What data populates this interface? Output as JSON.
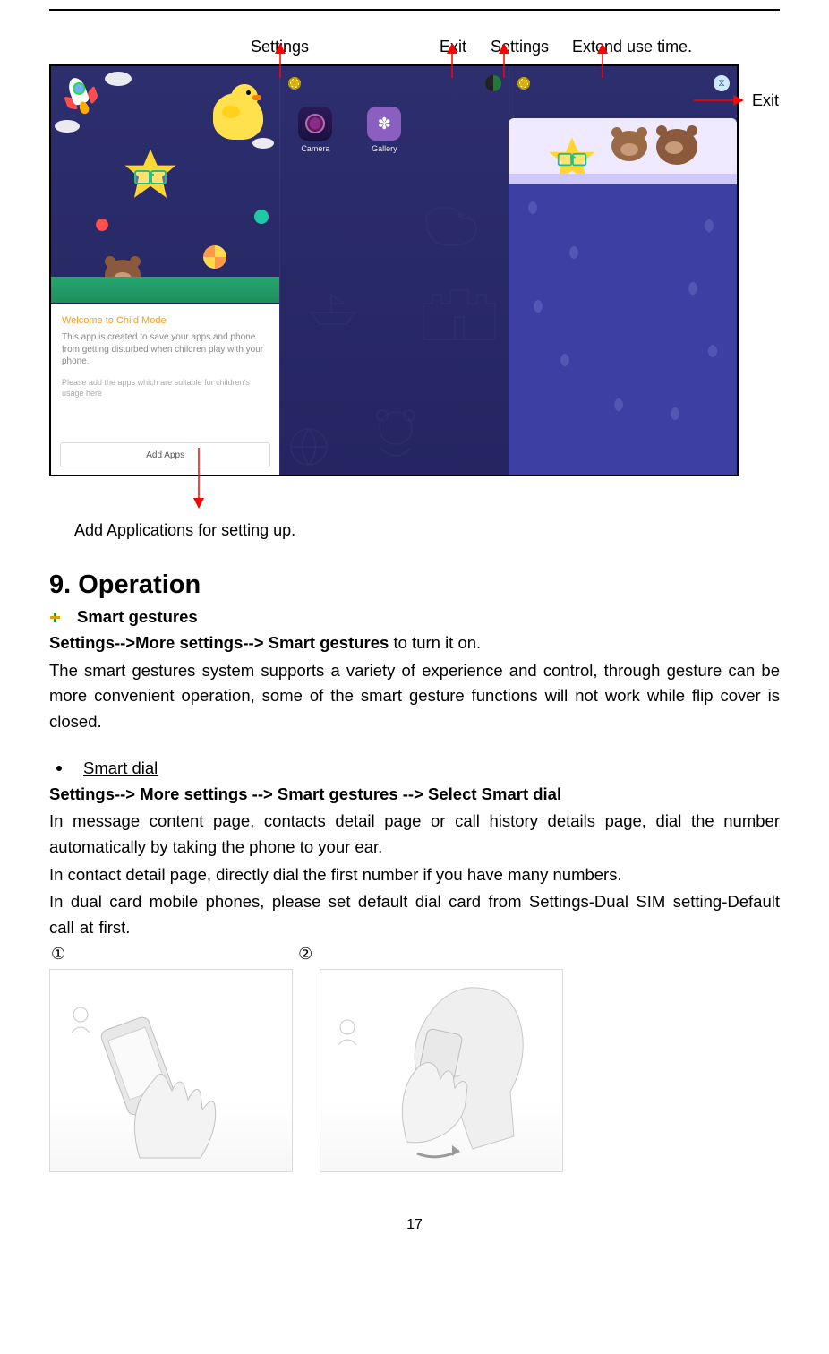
{
  "labels": {
    "settings1": "Settings",
    "exit1": "Exit",
    "settings2": "Settings",
    "extend": "Extend use time.",
    "exit_right": "Exit"
  },
  "screen1": {
    "welcome_title": "Welcome to Child Mode",
    "welcome_body": "This app is created to save your apps and phone from getting disturbed when children play with your phone.",
    "welcome_sub": "Please add the apps which are suitable for children's usage here",
    "add_apps": "Add Apps"
  },
  "screen2": {
    "apps": [
      {
        "label": "Camera"
      },
      {
        "label": "Gallery"
      }
    ]
  },
  "add_caption": "Add Applications for setting up.",
  "section": {
    "heading_number": "9.",
    "heading_text": "Operation",
    "smart_gestures": "Smart gestures",
    "path1_bold": "Settings-->More settings--> Smart gestures",
    "path1_rest": " to turn it on.",
    "para1": "The smart gestures system supports a variety of experience and control, through gesture can be more convenient operation, some of the smart gesture functions will not work while flip cover is closed.",
    "smart_dial": "Smart dial",
    "path2_bold": "Settings--> More settings --> Smart gestures --> Select Smart dial",
    "para2a": "In message content page, contacts detail page or call history details page, dial the number automatically by taking the phone to your ear.",
    "para2b": "In contact detail page, directly dial the first number if you have many numbers.",
    "para2c": "In dual card mobile phones, please set default dial card from Settings-Dual SIM setting-Default call at first.",
    "circ1": "①",
    "circ2": "②"
  },
  "page_number": "17"
}
